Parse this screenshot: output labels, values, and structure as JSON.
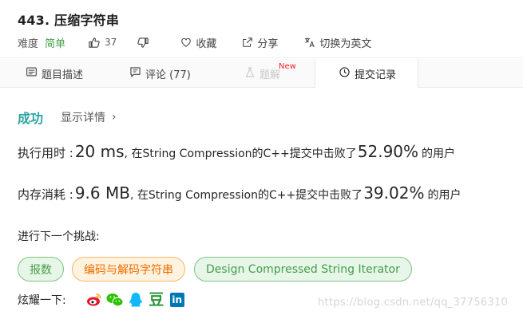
{
  "problem": {
    "title": "443. 压缩字符串",
    "difficulty_label": "难度",
    "difficulty": "简单",
    "likes": "37",
    "favorite_label": "收藏",
    "share_label": "分享",
    "lang_switch_label": "切换为英文"
  },
  "tabs": [
    {
      "label": "题目描述",
      "icon": "description-icon"
    },
    {
      "label": "评论 (77)",
      "icon": "comment-icon"
    },
    {
      "label": "题解",
      "icon": "flask-icon",
      "badge": "New"
    },
    {
      "label": "提交记录",
      "icon": "clock-icon",
      "active": true
    }
  ],
  "result": {
    "status": "成功",
    "details_label": "显示详情",
    "details_chevron": "›"
  },
  "runtime": {
    "label": "执行用时 : ",
    "value": "20 ms",
    "middle": ", 在String Compression的C++提交中击败了",
    "percent": "52.90%",
    "tail": "的用户"
  },
  "memory": {
    "label": "内存消耗 : ",
    "value": "9.6 MB",
    "middle": ", 在String Compression的C++提交中击败了",
    "percent": "39.02%",
    "tail": "的用户"
  },
  "next": {
    "label": "进行下一个挑战:",
    "chips": [
      "报数",
      "编码与解码字符串",
      "Design Compressed String Iterator"
    ]
  },
  "share": {
    "label": "炫耀一下:",
    "icons": [
      "weibo-icon",
      "wechat-icon",
      "qq-icon",
      "douban-icon",
      "linkedin-icon"
    ],
    "douban_glyph": "豆",
    "linkedin_glyph": "in"
  },
  "watermark": "https://blog.csdn.net/qq_37756310",
  "colors": {
    "success": "#2ca4a4",
    "easy": "#43a047",
    "new_badge": "#f5222d",
    "chip_green_bg": "#e8f5e9",
    "chip_orange_bg": "#fff3e0"
  }
}
